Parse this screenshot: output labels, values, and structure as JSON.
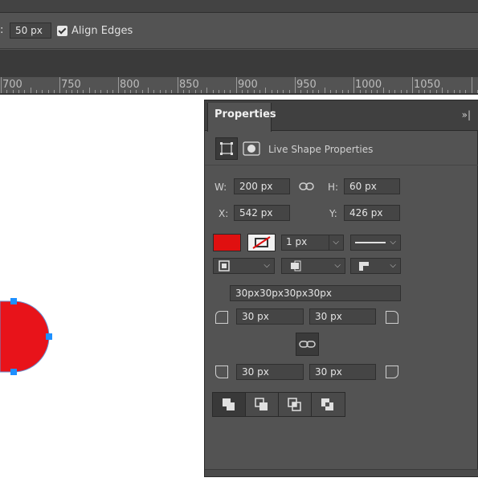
{
  "options_bar": {
    "leading_label": ":",
    "radius_value": "50 px",
    "align_edges_label": "Align Edges",
    "align_edges_checked": true
  },
  "ruler": {
    "ticks": [
      "700",
      "750",
      "800",
      "850",
      "900",
      "950",
      "1000",
      "1050"
    ]
  },
  "properties": {
    "tab_title": "Properties",
    "collapse_icon": "double-chevron-right-icon",
    "section_title": "Live Shape Properties",
    "w_label": "W:",
    "w_value": "200 px",
    "h_label": "H:",
    "h_value": "60 px",
    "x_label": "X:",
    "x_value": "542 px",
    "y_label": "Y:",
    "y_value": "426 px",
    "fill_color": "#e01010",
    "stroke_width": "1 px",
    "corner_radii_summary": "30px30px30px30px",
    "top_left_radius": "30 px",
    "top_right_radius": "30 px",
    "bottom_left_radius": "30 px",
    "bottom_right_radius": "30 px"
  },
  "colors": {
    "shape_fill": "#e8131a",
    "handle": "#1e90ff",
    "panel_bg": "#535353"
  }
}
